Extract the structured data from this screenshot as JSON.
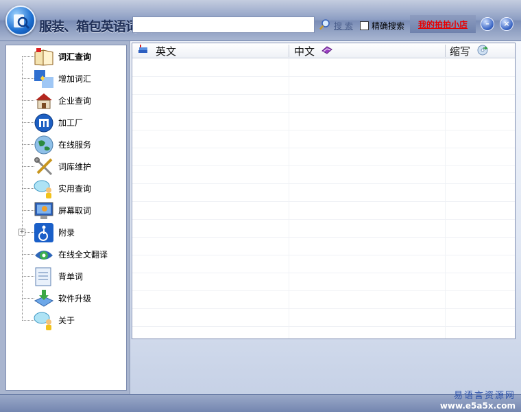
{
  "window": {
    "title": "服装、箱包英语词汇通",
    "search_placeholder": "",
    "search_value": "",
    "search_button": "搜 索",
    "exact_search_label": "精确搜索",
    "shop_link": "我的拍拍小店",
    "minimize_glyph": "–",
    "close_glyph": "×"
  },
  "sidebar": {
    "items": [
      {
        "label": "词汇查询",
        "icon": "book-icon",
        "active": true
      },
      {
        "label": "增加词汇",
        "icon": "add-word-icon"
      },
      {
        "label": "企业查询",
        "icon": "house-icon"
      },
      {
        "label": "加工厂",
        "icon": "factory-icon"
      },
      {
        "label": "在线服务",
        "icon": "globe-icon"
      },
      {
        "label": "词库维护",
        "icon": "tools-icon"
      },
      {
        "label": "实用查询",
        "icon": "chat-user-icon"
      },
      {
        "label": "屏幕取词",
        "icon": "monitor-icon"
      },
      {
        "label": "附录",
        "icon": "accessibility-icon",
        "expandable": true,
        "expander": "+"
      },
      {
        "label": "在线全文翻译",
        "icon": "translate-eye-icon"
      },
      {
        "label": "背单词",
        "icon": "notepad-icon"
      },
      {
        "label": "软件升级",
        "icon": "upgrade-icon"
      },
      {
        "label": "关于",
        "icon": "chat-user-icon"
      }
    ]
  },
  "grid": {
    "columns": [
      {
        "label": "英文",
        "icon": "book-stack-icon"
      },
      {
        "label": "中文",
        "icon": "purple-book-icon"
      },
      {
        "label": "缩写",
        "icon": "disc-arrow-icon"
      }
    ],
    "rows": []
  },
  "watermark": {
    "cn": "易语言资源网",
    "url": "www.e5a5x.com"
  },
  "colors": {
    "title_bg": "#8d9ec3",
    "shop_link": "#e80000",
    "accent": "#1b6ed0"
  }
}
